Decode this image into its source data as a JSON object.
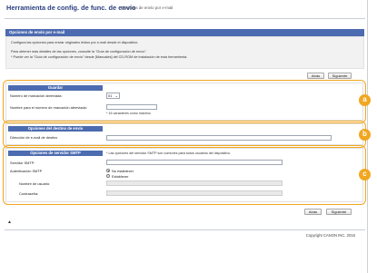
{
  "header": {
    "app_title": "Herramienta de config. de func. de envío",
    "sub_title": "Opciones de envío por e-mail"
  },
  "section": {
    "title": "Opciones de envío por e-mail",
    "desc_line1": "Configura las opciones para enviar originales leídos por e-mail desde el dispositivo.",
    "desc_line2": "Para obtener más detalles de las opciones, consulte la \"Guía de configuración de envío\".",
    "desc_line3": "* Puede ver la \"Guía de configuración de envío\" desde [Manuales] del CD-ROM de instalación de esta herramienta."
  },
  "buttons": {
    "back": "Atrás",
    "next": "Siguiente"
  },
  "save_panel": {
    "title": "Guardar",
    "abbrev_number_label": "Número de marcación abreviada:",
    "abbrev_number_value": "01",
    "abbrev_name_label": "Nombre para el número de marcación abreviada:",
    "abbrev_name_value": "",
    "abbrev_name_note": "* 16 caracteres como máximo"
  },
  "dest_panel": {
    "title": "Opciones del destino de envío",
    "email_label": "Dirección de e-mail de destino",
    "email_value": ""
  },
  "smtp_panel": {
    "title": "Opciones de servidor SMTP",
    "note": "* Las opciones del servidor SMTP son comunes para todos usuarios del dispositivo.",
    "server_label": "Servidor SMTP:",
    "server_value": "",
    "auth_label": "Autenticación SMTP",
    "auth_options": [
      "No establecer",
      "Establecer"
    ],
    "auth_selected": "No establecer",
    "user_label": "Nombre de usuario:",
    "password_label": "Contraseña:"
  },
  "callouts": [
    "a",
    "b",
    "c"
  ],
  "footer": {
    "copyright": "Copyright CANON INC. 2016",
    "top_icon": "▲"
  },
  "colors": {
    "accent_blue": "#4c6bb0",
    "highlight_orange": "#f0a721",
    "title_text": "#2a3f80"
  }
}
